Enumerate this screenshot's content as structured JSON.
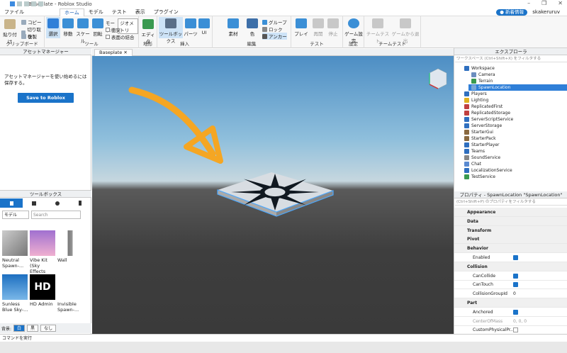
{
  "window": {
    "title": "Baseplate - Roblox Studio"
  },
  "menu": {
    "file": "ファイル",
    "tabs": [
      "ホーム",
      "モデル",
      "テスト",
      "表示",
      "プラグイン"
    ],
    "news": "新着情報",
    "user": "skakeruruv"
  },
  "ribbon": {
    "clipboard": {
      "paste": "貼り付け",
      "copy": "コピー",
      "cut": "切り取り",
      "duplicate": "複製",
      "label": "クリップボード"
    },
    "tools": {
      "select": "選択",
      "move": "移動",
      "scale": "スケール",
      "rotate": "回転",
      "mode_label": "モード:",
      "mode_value": "ジオメトリ",
      "collisions": "衝突",
      "join_surfaces": "表面の結合",
      "label": "ツール"
    },
    "terrain": {
      "editor": "エディタ",
      "label": "地形"
    },
    "insert": {
      "toolbox": "ツールボックス",
      "part": "パーツ",
      "ui": "UI",
      "label": "挿入"
    },
    "edit": {
      "material": "素材",
      "color": "色",
      "group": "グループ",
      "lock": "ロック",
      "anchor": "アンカー",
      "label": "編集"
    },
    "test": {
      "play": "プレイ",
      "resume": "再開",
      "stop": "停止",
      "label": "テスト"
    },
    "settings": {
      "game_settings": "ゲーム設定",
      "label": "設定"
    },
    "team_test": {
      "team_test": "チームテスト",
      "exit_game": "ゲームから退出",
      "label": "チームテスト"
    }
  },
  "asset_manager": {
    "title": "アセットマネージャー",
    "message": "アセットマネージャーを使い始めるには保存する。",
    "save_button": "Save to Roblox"
  },
  "toolbox": {
    "title": "ツールボックス",
    "category": "モデル",
    "search_placeholder": "Search",
    "items": [
      {
        "name": "Neutral Spawn-..."
      },
      {
        "name": "Vibe Kit (Sky Effects Only)"
      },
      {
        "name": "Wall"
      },
      {
        "name": "Sunless Blue Sky-..."
      },
      {
        "name": "HD Admin"
      },
      {
        "name": "Invisible Spawn-..."
      }
    ],
    "hd_logo": "HD",
    "bg_label": "背景:",
    "bg_white": "白",
    "bg_black": "黒",
    "bg_none": "なし"
  },
  "viewport": {
    "tab": "Baseplate"
  },
  "explorer": {
    "title": "エクスプローラ",
    "filter": "ワークスペース (Ctrl+Shift+X) をフィルタする",
    "items": [
      {
        "label": "Workspace",
        "indent": 0,
        "icon": "#2f6fbf"
      },
      {
        "label": "Camera",
        "indent": 1,
        "icon": "#6c8ebf"
      },
      {
        "label": "Terrain",
        "indent": 1,
        "icon": "#3a9a50"
      },
      {
        "label": "SpawnLocation",
        "indent": 1,
        "icon": "#7aa8d8",
        "selected": true
      },
      {
        "label": "Players",
        "indent": 0,
        "icon": "#2f6fbf"
      },
      {
        "label": "Lighting",
        "indent": 0,
        "icon": "#e0b020"
      },
      {
        "label": "ReplicatedFirst",
        "indent": 0,
        "icon": "#c04040"
      },
      {
        "label": "ReplicatedStorage",
        "indent": 0,
        "icon": "#c04040"
      },
      {
        "label": "ServerScriptService",
        "indent": 0,
        "icon": "#2f6fbf"
      },
      {
        "label": "ServerStorage",
        "indent": 0,
        "icon": "#2f6fbf"
      },
      {
        "label": "StarterGui",
        "indent": 0,
        "icon": "#8a6a40"
      },
      {
        "label": "StarterPack",
        "indent": 0,
        "icon": "#8a6a40"
      },
      {
        "label": "StarterPlayer",
        "indent": 0,
        "icon": "#2f6fbf"
      },
      {
        "label": "Teams",
        "indent": 0,
        "icon": "#2f6fbf"
      },
      {
        "label": "SoundService",
        "indent": 0,
        "icon": "#888888"
      },
      {
        "label": "Chat",
        "indent": 0,
        "icon": "#5a8ad0"
      },
      {
        "label": "LocalizationService",
        "indent": 0,
        "icon": "#2f6fbf"
      },
      {
        "label": "TestService",
        "indent": 0,
        "icon": "#3a9a50"
      }
    ]
  },
  "properties": {
    "title": "プロパティ - SpawnLocation \"SpawnLocation\"",
    "filter": "(Ctrl+Shift+P) のプロパティをフィルタする",
    "rows": [
      {
        "type": "cat",
        "label": "Appearance"
      },
      {
        "type": "cat",
        "label": "Data"
      },
      {
        "type": "cat",
        "label": "Transform"
      },
      {
        "type": "cat",
        "label": "Pivot"
      },
      {
        "type": "cat",
        "label": "Behavior"
      },
      {
        "type": "prop",
        "label": "Enabled",
        "check": true
      },
      {
        "type": "cat",
        "label": "Collision"
      },
      {
        "type": "prop",
        "label": "CanCollide",
        "check": true
      },
      {
        "type": "prop",
        "label": "CanTouch",
        "check": true
      },
      {
        "type": "prop",
        "label": "CollisionGroupId",
        "value": "0"
      },
      {
        "type": "cat",
        "label": "Part"
      },
      {
        "type": "prop",
        "label": "Anchored",
        "check": true
      },
      {
        "type": "prop",
        "label": "CenterOfMass",
        "value": "0, 0, 0",
        "dim": true
      },
      {
        "type": "prop",
        "label": "CustomPhysicalPr...",
        "check": false
      }
    ]
  },
  "command_bar": {
    "placeholder": "コマンドを実行"
  },
  "colors": {
    "accent": "#1a73c9",
    "arrow": "#f5a623",
    "selection": "#2f7fd8"
  }
}
